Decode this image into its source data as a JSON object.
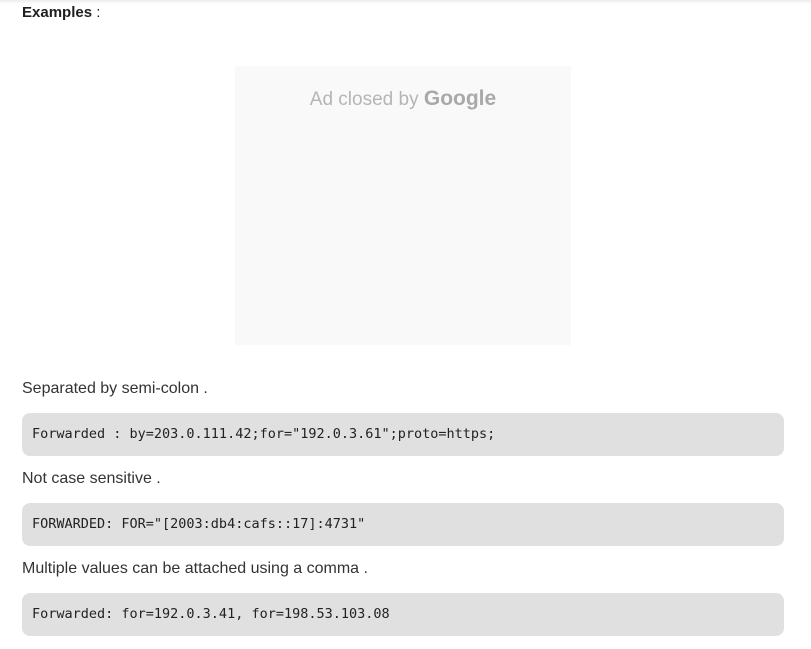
{
  "heading": {
    "label": "Examples",
    "suffix": " :"
  },
  "ad": {
    "closed_text": "Ad closed by",
    "brand": "Google"
  },
  "examples": [
    {
      "description": "Separated by semi-colon .",
      "code": "Forwarded : by=203.0.111.42;for=\"192.0.3.61\";proto=https;"
    },
    {
      "description": "Not case sensitive .",
      "code": "FORWARDED: FOR=\"[2003:db4:cafs::17]:4731\""
    },
    {
      "description": "Multiple values can be attached using a comma .",
      "code": "Forwarded: for=192.0.3.41, for=198.53.103.08"
    }
  ]
}
